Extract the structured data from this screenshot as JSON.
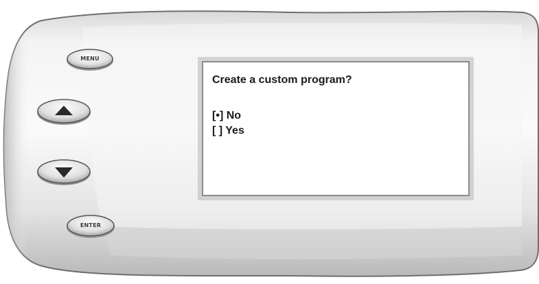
{
  "screen": {
    "title": "Create a custom program?",
    "options": [
      {
        "label": "No",
        "selected": true
      },
      {
        "label": "Yes",
        "selected": false
      }
    ]
  },
  "buttons": {
    "menu_label": "MENU",
    "enter_label": "ENTER",
    "up_icon": "triangle-up-icon",
    "down_icon": "triangle-down-icon"
  }
}
